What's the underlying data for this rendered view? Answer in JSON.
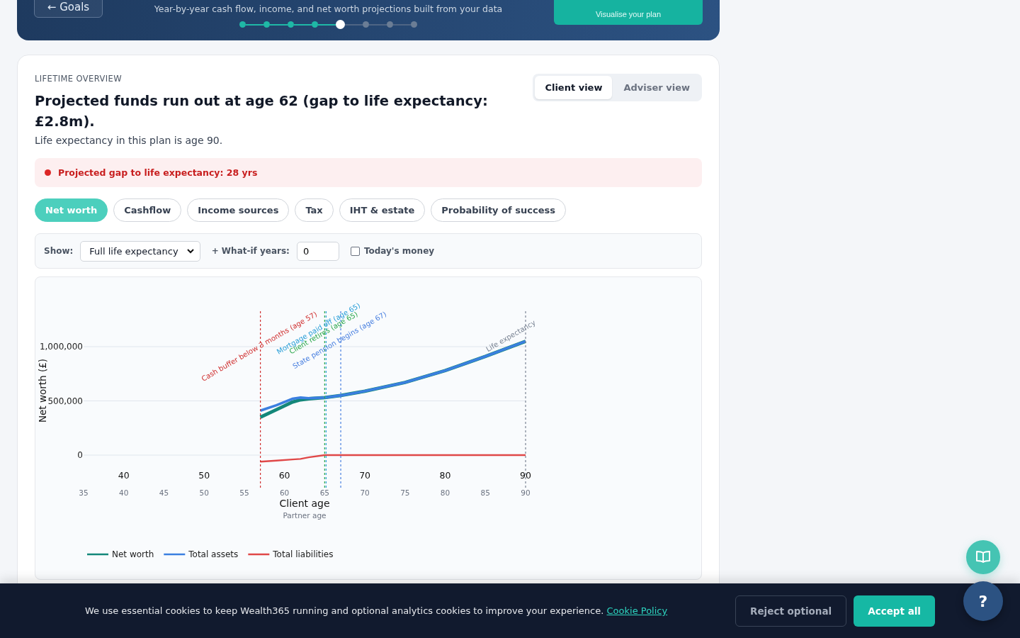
{
  "banner": {
    "back_button": "← Goals",
    "subtitle": "Year-by-year cash flow, income, and net worth projections built from your data",
    "steps": [
      {
        "completed": true,
        "current": false
      },
      {
        "completed": true,
        "current": false
      },
      {
        "completed": true,
        "current": false
      },
      {
        "completed": true,
        "current": false
      },
      {
        "completed": false,
        "current": true
      },
      {
        "completed": false,
        "current": false
      },
      {
        "completed": false,
        "current": false
      },
      {
        "completed": false,
        "current": false
      }
    ],
    "next_button": {
      "caption": "Visualise your plan"
    }
  },
  "overview": {
    "eyebrow": "LIFETIME OVERVIEW",
    "headline": "Projected funds run out at age 62 (gap to life expectancy: £2.8m).",
    "note": "Life expectancy in this plan is age 90.",
    "view_toggle": [
      {
        "label": "Client view",
        "selected": true
      },
      {
        "label": "Adviser view",
        "selected": false
      }
    ],
    "alert": {
      "text": "Projected gap to life expectancy: 28 yrs"
    },
    "tabs": [
      {
        "label": "Net worth",
        "selected": true
      },
      {
        "label": "Cashflow",
        "selected": false
      },
      {
        "label": "Income sources",
        "selected": false
      },
      {
        "label": "Tax",
        "selected": false
      },
      {
        "label": "IHT & estate",
        "selected": false
      },
      {
        "label": "Probability of success",
        "selected": false
      }
    ],
    "controls": {
      "show_label": "Show:",
      "show_value": "Full life expectancy",
      "what_if_label": "+ What-if years:",
      "what_if_value": "0",
      "todays_money": {
        "label": "Today's money",
        "checked": false
      }
    },
    "chart": {
      "partner_axis_label": "Partner age",
      "partner_ticks": [
        "35",
        "40",
        "45",
        "50",
        "55",
        "60",
        "65",
        "70",
        "75",
        "80",
        "85",
        "90"
      ],
      "chart_data": {
        "type": "line",
        "xlabel": "Client age",
        "ylabel": "Net worth (£)",
        "xlim": [
          35,
          90
        ],
        "ylim": [
          -307000,
          1327000
        ],
        "grid": true,
        "legend": "bottom",
        "x": [
          57,
          59,
          61,
          62,
          63,
          65,
          67,
          70,
          75,
          80,
          85,
          90
        ],
        "series": [
          {
            "name": "Net worth",
            "color": "#14877a",
            "values": [
              350000,
              420000,
              490000,
              510000,
              520000,
              530000,
              550000,
              590000,
              670000,
              780000,
              910000,
              1050000
            ]
          },
          {
            "name": "Total assets",
            "color": "#3b7fe0",
            "values": [
              410000,
              460000,
              520000,
              530000,
              525000,
              530000,
              550000,
              590000,
              670000,
              780000,
              910000,
              1050000
            ]
          },
          {
            "name": "Total liabilities",
            "color": "#e04848",
            "values": [
              -60000,
              -50000,
              -40000,
              -35000,
              -20000,
              0,
              0,
              0,
              0,
              0,
              0,
              0
            ]
          }
        ],
        "xticks": [
          40,
          50,
          60,
          70,
          80,
          90
        ],
        "yticks": [
          {
            "value": 0,
            "label": "0"
          },
          {
            "value": 500000,
            "label": "500,000"
          },
          {
            "value": 1000000,
            "label": "1,000,000"
          }
        ],
        "ref_lines": [
          {
            "axis": "x",
            "value": 57,
            "label": "Cash buffer below 3 months (age 57)",
            "color": "#d03030"
          },
          {
            "axis": "x",
            "value": 65,
            "label": "Client retires (age 65)",
            "color": "#2aa84a"
          },
          {
            "axis": "x",
            "value": 65,
            "label": "Mortgage paid off (age 65)",
            "color": "#2a9fd8"
          },
          {
            "axis": "x",
            "value": 67,
            "label": "State pension begins (age 67)",
            "color": "#4a80e0"
          },
          {
            "axis": "x",
            "value": 90,
            "label": "Life expectancy",
            "color": "#7a8494"
          }
        ]
      }
    }
  },
  "cookie_banner": {
    "text": "We use essential cookies to keep Wealth365 running and optional analytics cookies to improve your experience.",
    "link": "Cookie Policy",
    "buttons": [
      {
        "label": "Reject optional",
        "kind": "secondary"
      },
      {
        "label": "Accept all",
        "kind": "primary"
      }
    ]
  },
  "help_button": "?"
}
